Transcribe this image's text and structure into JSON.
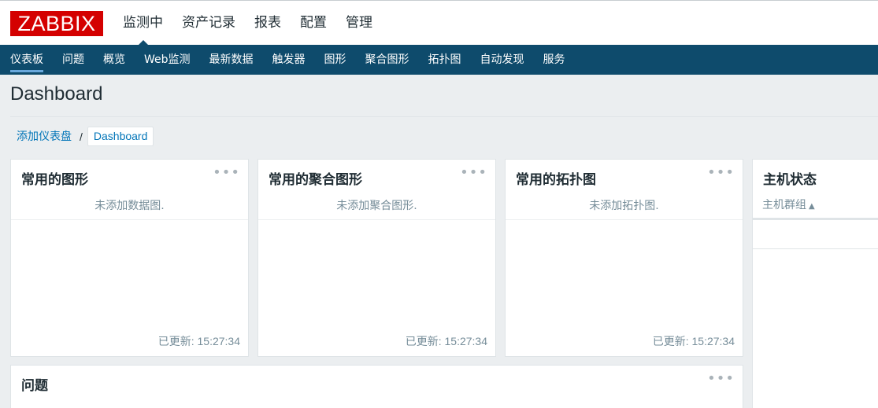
{
  "logo": "ZABBIX",
  "main_menu": [
    {
      "label": "监测中",
      "active": true
    },
    {
      "label": "资产记录",
      "active": false
    },
    {
      "label": "报表",
      "active": false
    },
    {
      "label": "配置",
      "active": false
    },
    {
      "label": "管理",
      "active": false
    }
  ],
  "sub_nav": [
    {
      "label": "仪表板",
      "active": true
    },
    {
      "label": "问题",
      "active": false
    },
    {
      "label": "概览",
      "active": false
    },
    {
      "label": "Web监测",
      "active": false
    },
    {
      "label": "最新数据",
      "active": false
    },
    {
      "label": "触发器",
      "active": false
    },
    {
      "label": "图形",
      "active": false
    },
    {
      "label": "聚合图形",
      "active": false
    },
    {
      "label": "拓扑图",
      "active": false
    },
    {
      "label": "自动发现",
      "active": false
    },
    {
      "label": "服务",
      "active": false
    }
  ],
  "page": {
    "title": "Dashboard"
  },
  "breadcrumb": {
    "link": "添加仪表盘",
    "separator": "/",
    "current": "Dashboard"
  },
  "widgets": {
    "favorite_graphs": {
      "title": "常用的图形",
      "empty": "未添加数据图.",
      "updated": "已更新: 15:27:34",
      "menu": "•••"
    },
    "favorite_screens": {
      "title": "常用的聚合图形",
      "empty": "未添加聚合图形.",
      "updated": "已更新: 15:27:34",
      "menu": "•••"
    },
    "favorite_maps": {
      "title": "常用的拓扑图",
      "empty": "未添加拓扑图.",
      "updated": "已更新: 15:27:34",
      "menu": "•••"
    },
    "host_status": {
      "title": "主机状态",
      "column": "主机群组",
      "sort_icon": "▲"
    },
    "problems": {
      "title": "问题",
      "menu": "•••"
    }
  },
  "colors": {
    "brand_red": "#d40000",
    "nav_blue": "#0e4b6c",
    "link_blue": "#0275b8"
  }
}
